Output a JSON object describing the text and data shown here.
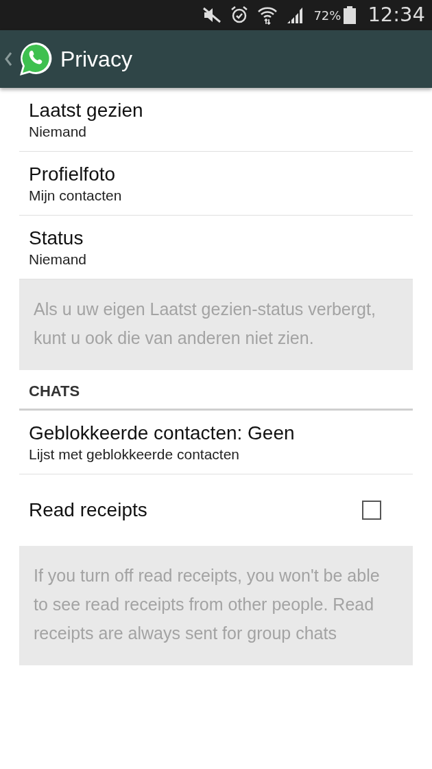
{
  "status_bar": {
    "battery_percent": "72%",
    "time": "12:34"
  },
  "header": {
    "title": "Privacy"
  },
  "items": [
    {
      "kind": "setting",
      "title": "Laatst gezien",
      "subtitle": "Niemand"
    },
    {
      "kind": "setting",
      "title": "Profielfoto",
      "subtitle": "Mijn contacten"
    },
    {
      "kind": "setting",
      "title": "Status",
      "subtitle": "Niemand"
    },
    {
      "kind": "info",
      "text": "Als u uw eigen Laatst gezien-status verbergt, kunt u ook die van anderen niet zien."
    },
    {
      "kind": "section",
      "text": "CHATS"
    },
    {
      "kind": "setting",
      "title": "Geblokkeerde contacten: Geen",
      "subtitle": "Lijst met geblokkeerde contacten"
    },
    {
      "kind": "checkbox",
      "title": "Read receipts",
      "checked": false
    },
    {
      "kind": "info",
      "text": "If you turn off read receipts, you won't be able to see read receipts from other people. Read receipts are always sent for group chats"
    }
  ]
}
